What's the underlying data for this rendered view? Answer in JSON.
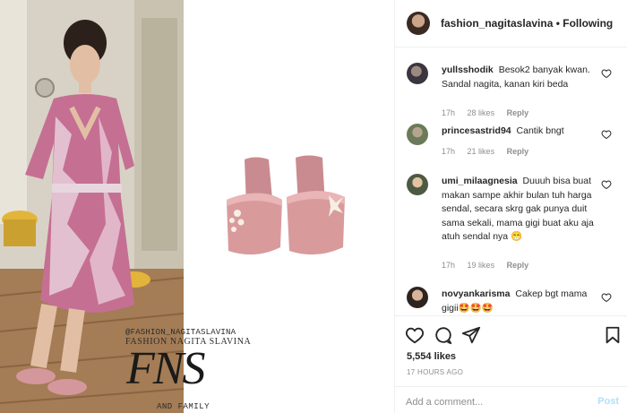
{
  "post": {
    "watermark": {
      "handle": "@FASHION_NAGITASLAVINA",
      "name": "FASHION NAGITA SLAVINA",
      "monogram": "FNS",
      "tagline": "AND FAMILY"
    }
  },
  "header": {
    "username": "fashion_nagitaslavina",
    "separator": "•",
    "follow_label": "Following"
  },
  "comments": [
    {
      "username": "yullsshodik",
      "text": "Besok2 banyak kwan. Sandal nagita, kanan kiri beda",
      "time": "17h",
      "likes": "28 likes",
      "reply": "Reply"
    },
    {
      "username": "princesastrid94",
      "text": "Cantik bngt",
      "time": "17h",
      "likes": "21 likes",
      "reply": "Reply"
    },
    {
      "username": "umi_milaagnesia",
      "text": "Duuuh bisa buat makan sampe akhir bulan tuh harga sendal, secara skrg gak punya duit sama sekali, mama gigi buat aku aja atuh sendal nya 😁",
      "time": "17h",
      "likes": "19 likes",
      "reply": "Reply"
    },
    {
      "username": "novyankarisma",
      "text": "Cakep bgt mama gigii🤩🤩🤩",
      "time": "",
      "likes": "",
      "reply": ""
    }
  ],
  "actions": {
    "likes": "5,554 likes",
    "timestamp": "17 HOURS AGO",
    "comment_placeholder": "Add a comment...",
    "post_label": "Post"
  },
  "colors": {
    "accent_disabled": "#b2dffc",
    "muted_text": "#8e8e8e",
    "border": "#efefef",
    "sandal_pink": "#d99a9c"
  },
  "icons": [
    "heart-icon",
    "comment-icon",
    "share-icon",
    "bookmark-icon",
    "comment-like-icon"
  ]
}
